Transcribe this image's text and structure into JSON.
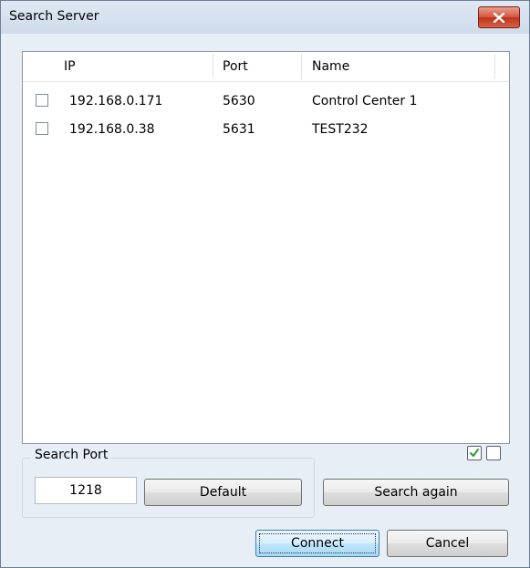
{
  "window": {
    "title": "Search Server"
  },
  "list": {
    "columns": [
      "IP",
      "Port",
      "Name"
    ],
    "rows": [
      {
        "ip": "192.168.0.171",
        "port": "5630",
        "name": "Control Center 1",
        "checked": false
      },
      {
        "ip": "192.168.0.38",
        "port": "5631",
        "name": "TEST232",
        "checked": false
      }
    ]
  },
  "search_port": {
    "label": "Search Port",
    "value": "1218",
    "default_label": "Default"
  },
  "toggles": {
    "check_all_checked": true,
    "uncheck_all_checked": false
  },
  "buttons": {
    "search_again": "Search again",
    "connect": "Connect",
    "cancel": "Cancel"
  }
}
